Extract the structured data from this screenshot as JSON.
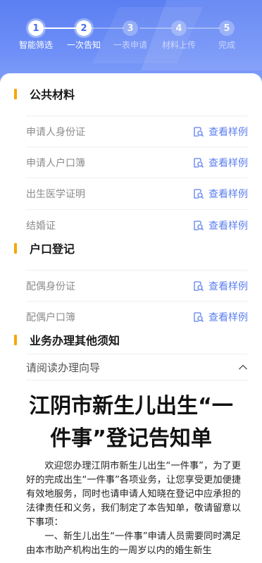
{
  "steps": [
    {
      "num": "1",
      "label": "智能筛选"
    },
    {
      "num": "2",
      "label": "一次告知"
    },
    {
      "num": "3",
      "label": "一表申请"
    },
    {
      "num": "4",
      "label": "材料上传"
    },
    {
      "num": "5",
      "label": "完成"
    }
  ],
  "sections": {
    "public": {
      "title": "公共材料",
      "items": [
        {
          "name": "申请人身份证",
          "link": "查看样例"
        },
        {
          "name": "申请人户口簿",
          "link": "查看样例"
        },
        {
          "name": "出生医学证明",
          "link": "查看样例"
        },
        {
          "name": "结婚证",
          "link": "查看样例"
        }
      ]
    },
    "hukou": {
      "title": "户口登记",
      "items": [
        {
          "name": "配偶身份证",
          "link": "查看样例"
        },
        {
          "name": "配偶户口簿",
          "link": "查看样例"
        }
      ]
    },
    "other": {
      "title": "业务办理其他须知",
      "guide_label": "请阅读办理向导"
    }
  },
  "notice": {
    "title": "江阴市新生儿出生“一件事”登记告知单",
    "para1": "欢迎您办理江阴市新生儿出生“一件事”，为了更好的完成出生“一件事”各项业务，让您享受更加便捷有效地服务，同时也请申请人知晓在登记中应承担的法律责任和义务，我们制定了本告知单，敬请留意以下事项：",
    "para2": "一、新生儿出生“一件事”申请人员需要同时满足由本市助产机构出生的一周岁以内的婚生新生"
  },
  "colors": {
    "accent": "#5c7fef",
    "section_bar": "#f5a70b",
    "header_bg": "#6f90f7"
  }
}
